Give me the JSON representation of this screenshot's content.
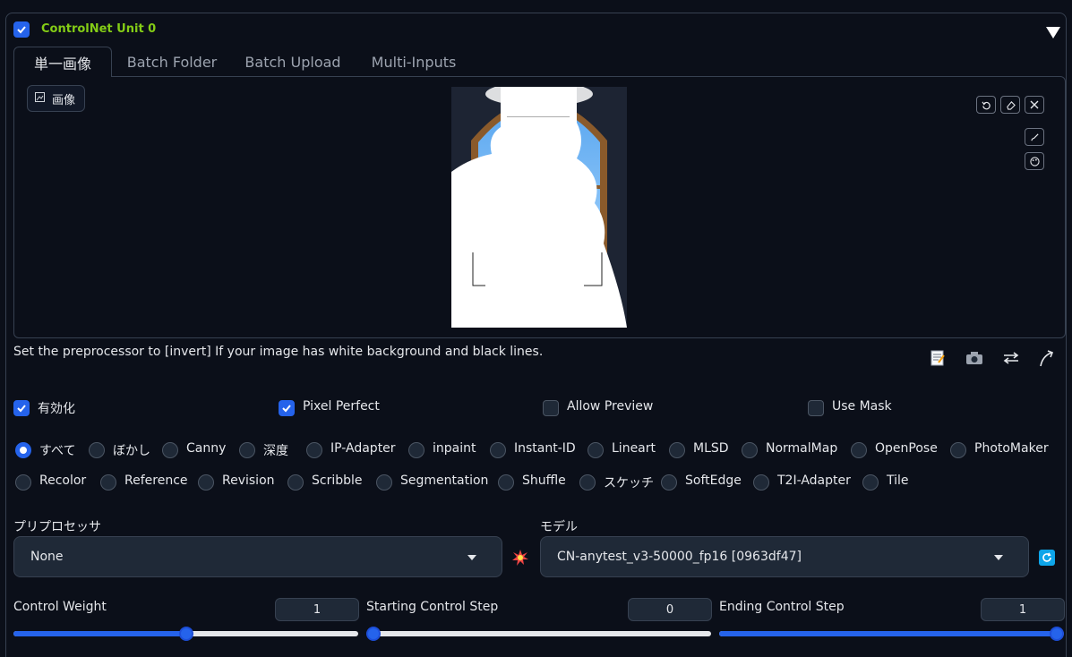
{
  "unit": {
    "enabled": true,
    "title": "ControlNet Unit 0",
    "collapse_icon": "triangle-down-icon"
  },
  "tabs": [
    {
      "label": "単一画像",
      "active": true
    },
    {
      "label": "Batch Folder",
      "active": false
    },
    {
      "label": "Batch Upload",
      "active": false
    },
    {
      "label": "Multi-Inputs",
      "active": false
    }
  ],
  "image_panel": {
    "badge_label": "画像",
    "badge_icon": "image-icon",
    "tools_top": [
      "undo-icon",
      "eraser-icon",
      "close-icon"
    ],
    "tools_side": [
      "brush-icon",
      "palette-icon"
    ]
  },
  "hint_text": "Set the preprocessor to [invert] If your image has white background and black lines.",
  "action_icons": [
    "memo-icon",
    "camera-icon",
    "swap-icon",
    "send-arrow-icon"
  ],
  "options": [
    {
      "label": "有効化",
      "checked": true
    },
    {
      "label": "Pixel Perfect",
      "checked": true
    },
    {
      "label": "Allow Preview",
      "checked": false
    },
    {
      "label": "Use Mask",
      "checked": false
    }
  ],
  "control_types_row1": [
    "すべて",
    "ぼかし",
    "Canny",
    "深度",
    "IP-Adapter",
    "inpaint",
    "Instant-ID",
    "Lineart",
    "MLSD",
    "NormalMap",
    "OpenPose",
    "PhotoMaker"
  ],
  "control_types_row2": [
    "Recolor",
    "Reference",
    "Revision",
    "Scribble",
    "Segmentation",
    "Shuffle",
    "スケッチ",
    "SoftEdge",
    "T2I-Adapter",
    "Tile"
  ],
  "selected_control_type": "すべて",
  "preprocessor": {
    "label": "プリプロセッサ",
    "value": "None"
  },
  "model": {
    "label": "モデル",
    "value": "CN-anytest_v3-50000_fp16 [0963df47]"
  },
  "run_icon": "explosion-icon",
  "refresh_icon": "refresh-icon",
  "sliders": [
    {
      "label": "Control Weight",
      "value": "1",
      "fraction": 0.5
    },
    {
      "label": "Starting Control Step",
      "value": "0",
      "fraction": 0.0
    },
    {
      "label": "Ending Control Step",
      "value": "1",
      "fraction": 1.0
    }
  ],
  "colors": {
    "accent": "#2563eb",
    "title": "#84cc16",
    "bg": "#0b0f19"
  }
}
